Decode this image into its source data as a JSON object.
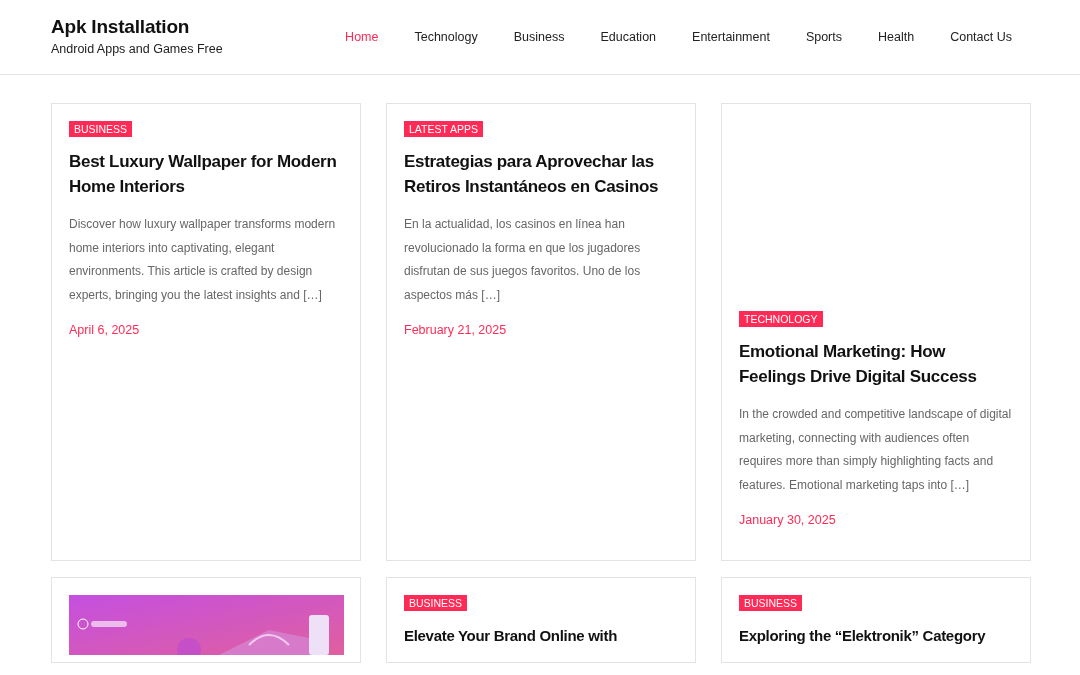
{
  "site": {
    "title": "Apk Installation",
    "tagline": "Android Apps and Games Free"
  },
  "nav": [
    {
      "label": "Home",
      "selected": true
    },
    {
      "label": "Technology",
      "selected": false
    },
    {
      "label": "Business",
      "selected": false
    },
    {
      "label": "Education",
      "selected": false
    },
    {
      "label": "Entertainment",
      "selected": false
    },
    {
      "label": "Sports",
      "selected": false
    },
    {
      "label": "Health",
      "selected": false
    },
    {
      "label": "Contact Us",
      "selected": false
    }
  ],
  "posts": [
    {
      "kind": "post",
      "category": "BUSINESS",
      "title": "Best Luxury Wallpaper for Modern Home Interiors",
      "excerpt": "Discover how luxury wallpaper transforms modern home interiors into captivating, elegant environments. This article is crafted by design experts, bringing you the latest insights and […]",
      "date": "April 6, 2025"
    },
    {
      "kind": "post",
      "category": "LATEST APPS",
      "title": "Estrategias para Aprovechar las Retiros Instantáneos en Casinos",
      "excerpt": "En la actualidad, los casinos en línea han revolucionado la forma en que los jugadores disfrutan de sus juegos favoritos. Uno de los aspectos más […]",
      "date": "February 21, 2025"
    },
    {
      "kind": "blank_top",
      "category": "TECHNOLOGY",
      "title": "Emotional Marketing: How Feelings Drive Digital Success",
      "excerpt": "In the crowded and competitive landscape of digital marketing, connecting with audiences often requires more than simply highlighting facts and features. Emotional marketing taps into […]",
      "date": "January 30, 2025"
    },
    {
      "kind": "picture"
    },
    {
      "kind": "post",
      "category": "BUSINESS",
      "title": "Elevate Your Brand Online with"
    },
    {
      "kind": "post",
      "category": "BUSINESS",
      "title": "Exploring the “Elektronik” Category"
    }
  ]
}
